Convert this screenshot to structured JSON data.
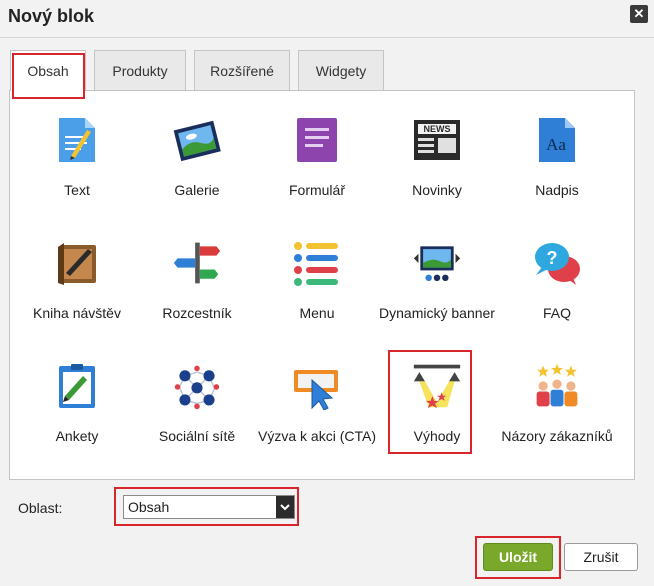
{
  "dialog": {
    "title": "Nový blok",
    "close_symbol": "✕"
  },
  "tabs": [
    {
      "label": "Obsah",
      "active": true
    },
    {
      "label": "Produkty",
      "active": false
    },
    {
      "label": "Rozšířené",
      "active": false
    },
    {
      "label": "Widgety",
      "active": false
    }
  ],
  "tiles": [
    {
      "label": "Text",
      "icon": "text-document-icon"
    },
    {
      "label": "Galerie",
      "icon": "gallery-icon"
    },
    {
      "label": "Formulář",
      "icon": "form-icon"
    },
    {
      "label": "Novinky",
      "icon": "news-icon",
      "badge": "NEWS"
    },
    {
      "label": "Nadpis",
      "icon": "heading-icon",
      "badge": "Aa"
    },
    {
      "label": "Kniha návštěv",
      "icon": "guestbook-icon"
    },
    {
      "label": "Rozcestník",
      "icon": "signpost-icon"
    },
    {
      "label": "Menu",
      "icon": "menu-icon"
    },
    {
      "label": "Dynamický banner",
      "icon": "dynamic-banner-icon"
    },
    {
      "label": "FAQ",
      "icon": "faq-icon",
      "badge": "?"
    },
    {
      "label": "Ankety",
      "icon": "poll-icon"
    },
    {
      "label": "Sociální sítě",
      "icon": "social-network-icon"
    },
    {
      "label": "Výzva k akci (CTA)",
      "icon": "call-to-action-icon"
    },
    {
      "label": "Výhody",
      "icon": "benefits-icon"
    },
    {
      "label": "Názory zákazníků",
      "icon": "customer-reviews-icon"
    }
  ],
  "area": {
    "label": "Oblast:",
    "value": "Obsah"
  },
  "actions": {
    "save_label": "Uložit",
    "cancel_label": "Zrušit"
  },
  "colors": {
    "accent_highlight": "#d9262c",
    "save_button": "#7aa82a"
  }
}
